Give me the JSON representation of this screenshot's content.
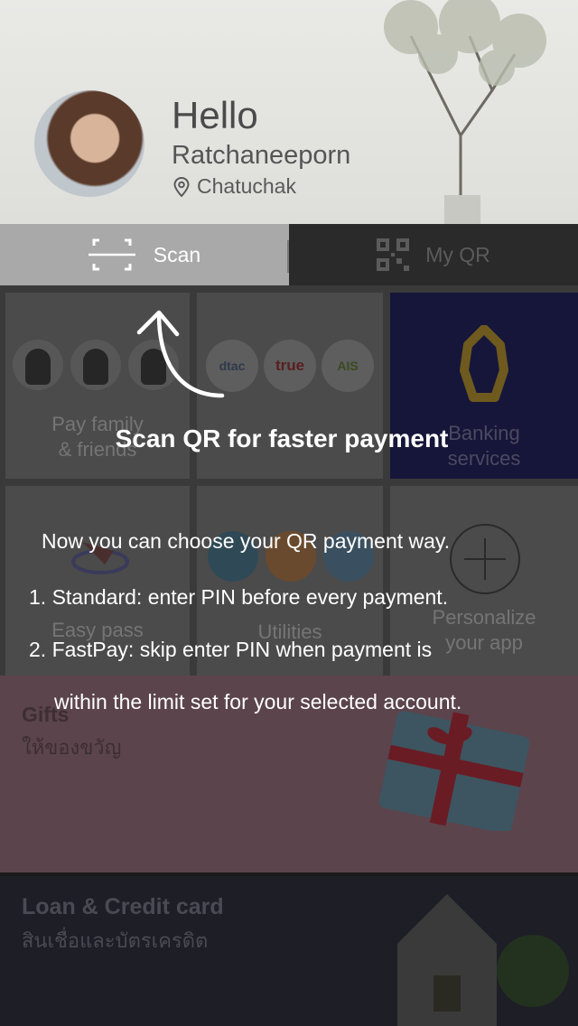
{
  "header": {
    "greeting": "Hello",
    "user_name": "Ratchaneeporn",
    "location": "Chatuchak",
    "location_icon": "map-pin-icon"
  },
  "tabs": {
    "scan_label": "Scan",
    "scan_icon": "scan-frame-icon",
    "myqr_label": "My QR",
    "myqr_icon": "qr-code-icon"
  },
  "grid": {
    "items": [
      {
        "label_line1": "Pay family",
        "label_line2": "& friends",
        "icon": "family-icon"
      },
      {
        "label_line1": "",
        "label_line2": "",
        "icon": "mobile-operator-icon",
        "operators": [
          "dtac",
          "true",
          "AIS"
        ]
      },
      {
        "label_line1": "Banking",
        "label_line2": "services",
        "icon": "bank-icon"
      },
      {
        "label_line1": "Easy pass",
        "label_line2": "",
        "icon": "easy-pass-icon"
      },
      {
        "label_line1": "Utilities",
        "label_line2": "",
        "icon": "utilities-icon"
      },
      {
        "label_line1": "Personalize",
        "label_line2": "your app",
        "icon": "plus-icon"
      }
    ]
  },
  "banners": {
    "gifts_title": "Gifts",
    "gifts_sub": "ให้ของขวัญ",
    "loan_title": "Loan & Credit card",
    "loan_sub": "สินเชื่อและบัตรเครดิต"
  },
  "coach": {
    "title": "Scan QR for faster payment",
    "lines": [
      "Now you can choose your QR payment way.",
      "1. Standard: enter PIN before every payment.",
      "2. FastPay: skip enter PIN when payment is",
      "within the limit set for your selected account."
    ]
  },
  "colors": {
    "bank_purple": "#16163a",
    "bank_gold": "#8a6d1d",
    "coach_text": "#ffffff",
    "active_tab": "#a9a9a9"
  }
}
